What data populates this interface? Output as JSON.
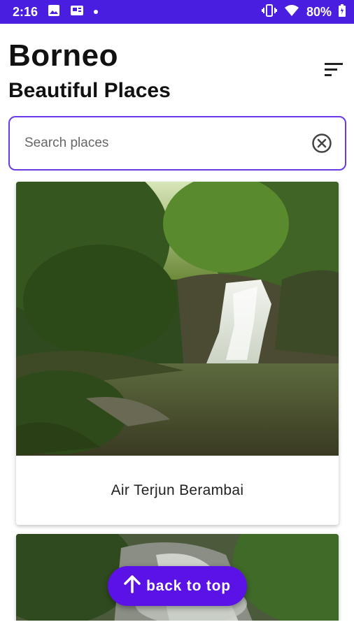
{
  "status_bar": {
    "time": "2:16",
    "battery": "80%",
    "icons": [
      "image-icon",
      "news-icon",
      "notification-dot-icon",
      "vibrate-icon",
      "wifi-icon",
      "battery-icon"
    ]
  },
  "header": {
    "title": "Borneo",
    "subtitle": "Beautiful Places",
    "sort_icon": "sort-icon"
  },
  "search": {
    "placeholder": "Search places",
    "value": "",
    "clear_icon": "clear-icon"
  },
  "places": [
    {
      "name": "Air Terjun Berambai"
    }
  ],
  "fab": {
    "label": "back to top",
    "icon": "arrow-up-icon"
  },
  "colors": {
    "status_bar": "#4a1ee0",
    "accent": "#5a12e6",
    "search_border": "#6a3ae8"
  }
}
